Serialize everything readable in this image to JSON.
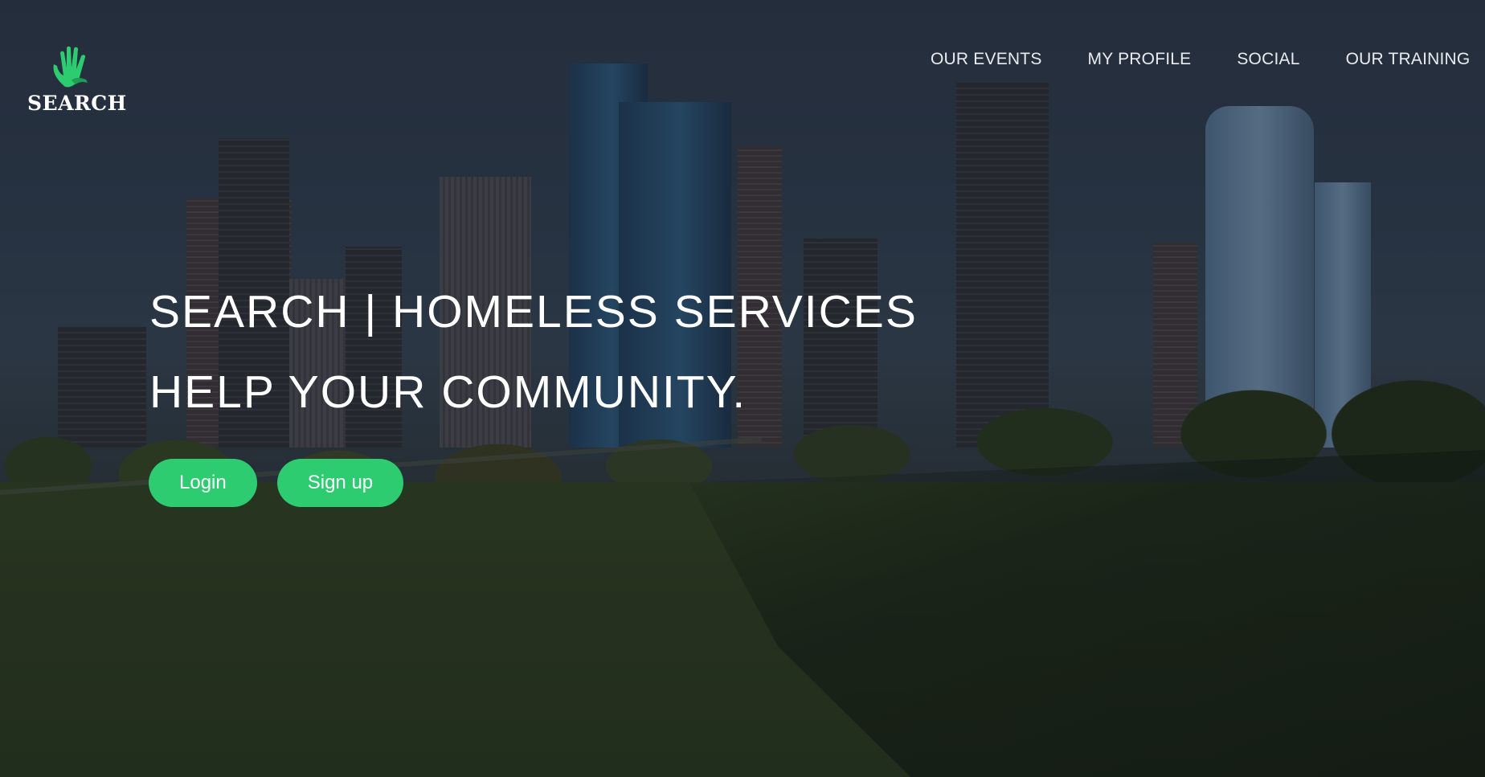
{
  "brand": {
    "name": "SEARCH",
    "logo_icon": "hands-icon",
    "accent": "#2ecc71"
  },
  "nav": {
    "items": [
      "OUR EVENTS",
      "MY PROFILE",
      "SOCIAL",
      "OUR TRAINING"
    ]
  },
  "hero": {
    "headline_line1": "SEARCH | HOMELESS SERVICES",
    "headline_line2": "HELP YOUR COMMUNITY.",
    "login_label": "Login",
    "signup_label": "Sign up"
  }
}
